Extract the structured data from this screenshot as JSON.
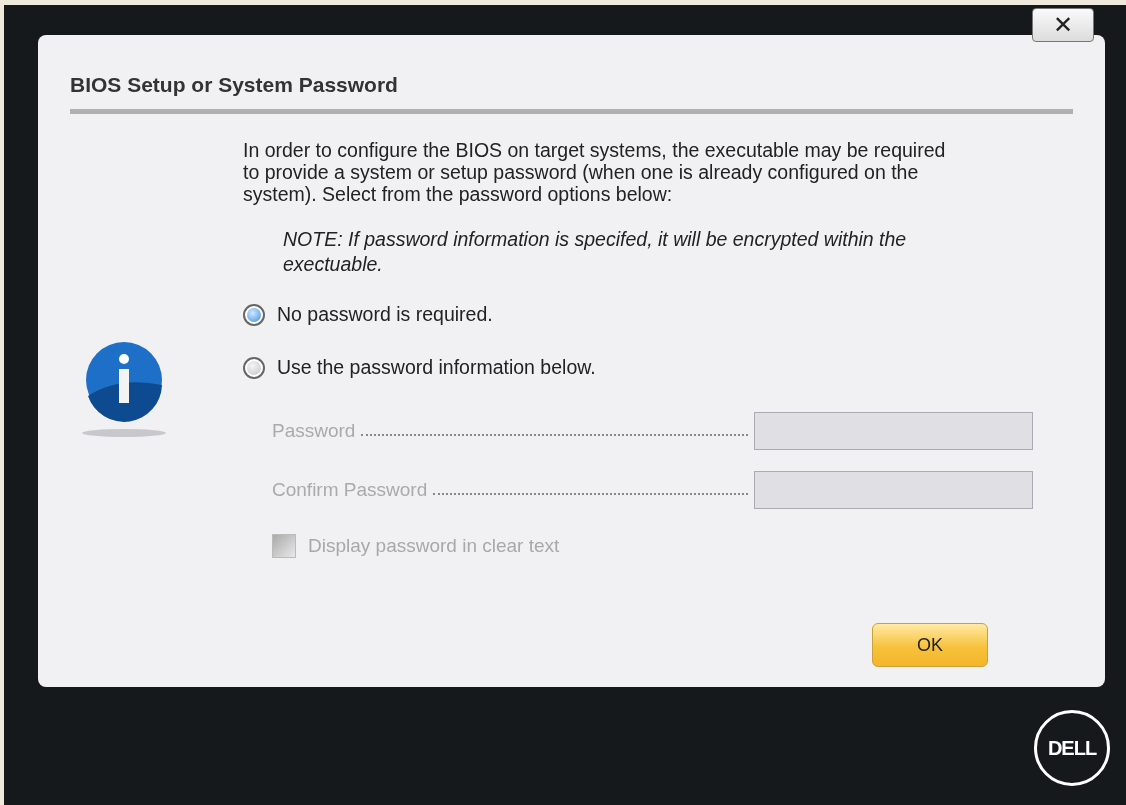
{
  "close_button": {
    "label": "✕"
  },
  "dialog": {
    "title": "BIOS Setup or System Password",
    "intro": "In order to configure the BIOS on target systems, the executable may be required to provide a system or setup password (when one is already configured on the system). Select from the password options below:",
    "note": "NOTE: If password information is specifed, it will be encrypted within the exectuable.",
    "options": [
      {
        "label": "No password is required.",
        "selected": true
      },
      {
        "label": "Use the password information below.",
        "selected": false
      }
    ],
    "fields": [
      {
        "label": "Password",
        "disabled": true
      },
      {
        "label": "Confirm Password",
        "disabled": true
      }
    ],
    "show_password": {
      "label": "Display password in clear text",
      "checked": false,
      "disabled": true
    },
    "ok_button": "OK"
  },
  "logo": {
    "text": "DELL"
  }
}
